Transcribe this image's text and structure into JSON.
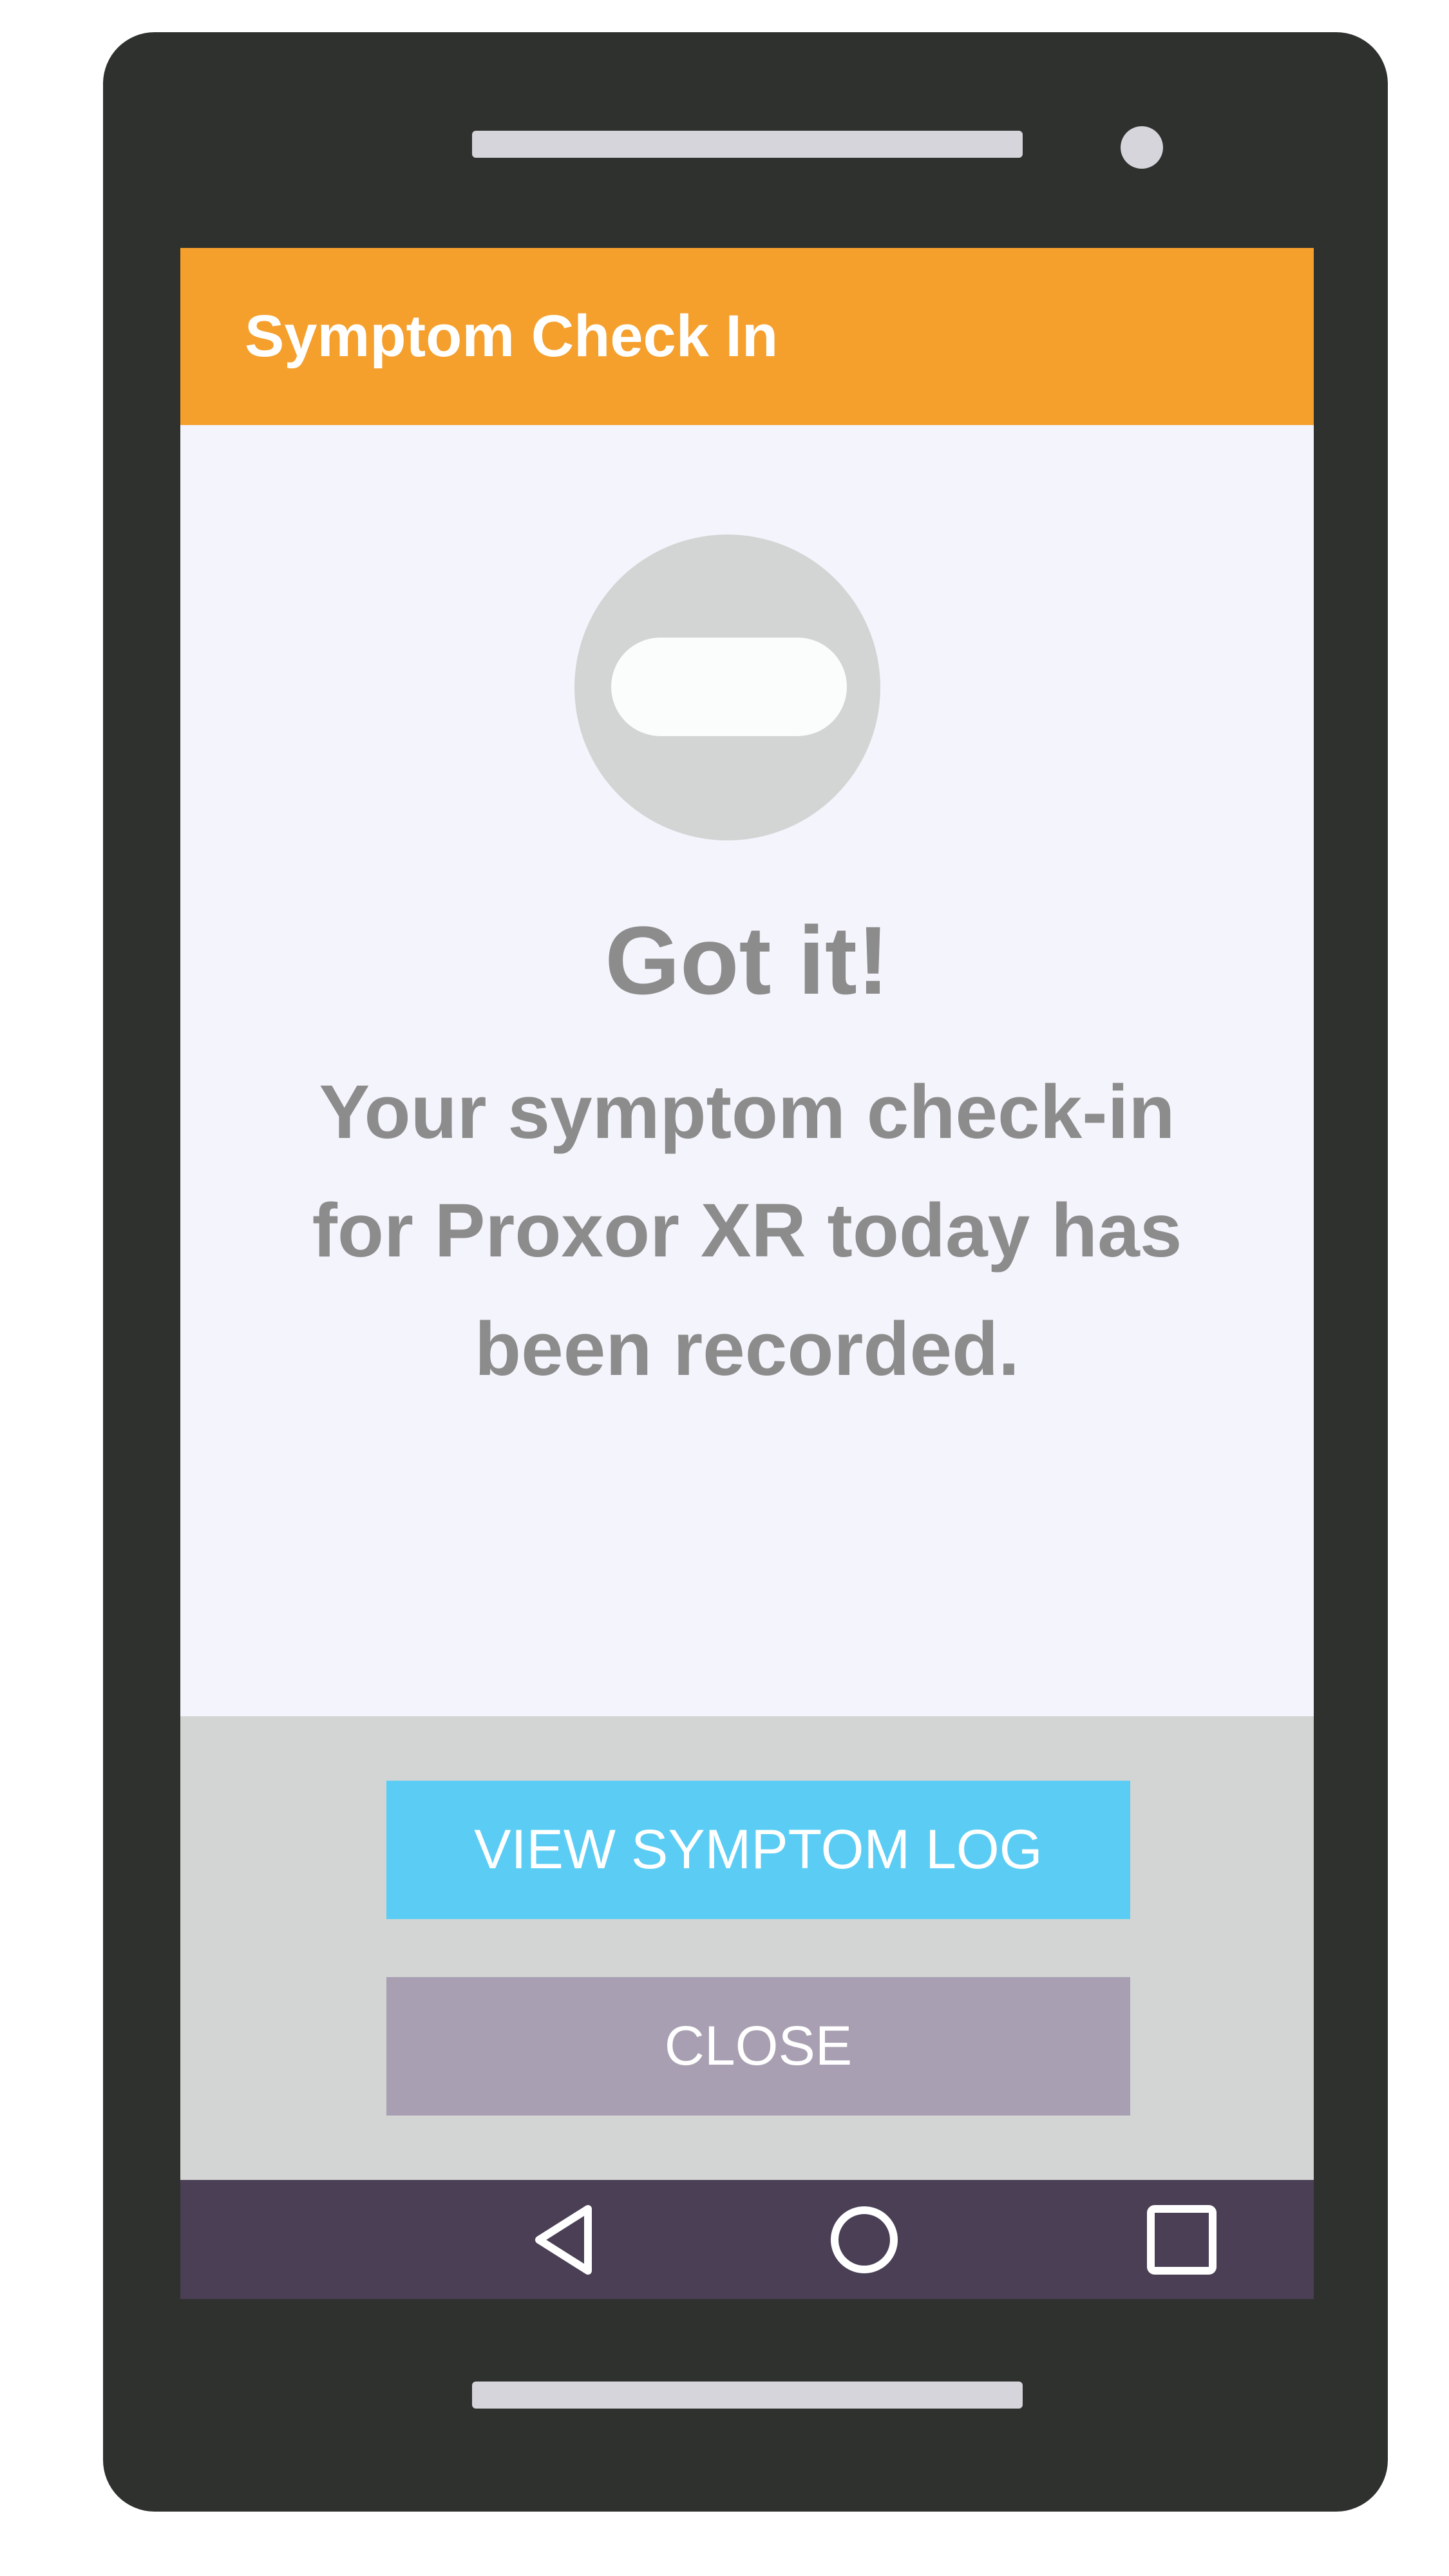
{
  "app_bar": {
    "title": "Symptom Check In",
    "color": "#f59f2d"
  },
  "status": {
    "icon": "minus-circle-icon",
    "headline": "Got it!",
    "message": "Your symptom check-in for Proxor XR today has been recorded."
  },
  "actions": {
    "primary_label": "VIEW SYMPTOM LOG",
    "primary_color": "#5bcdf4",
    "secondary_label": "CLOSE",
    "secondary_color": "#a8a0b2"
  },
  "nav_bar": {
    "items": [
      "back-icon",
      "home-icon",
      "recents-icon"
    ],
    "color": "#4a3f54"
  },
  "device": {
    "frame_color": "#2e312d"
  }
}
